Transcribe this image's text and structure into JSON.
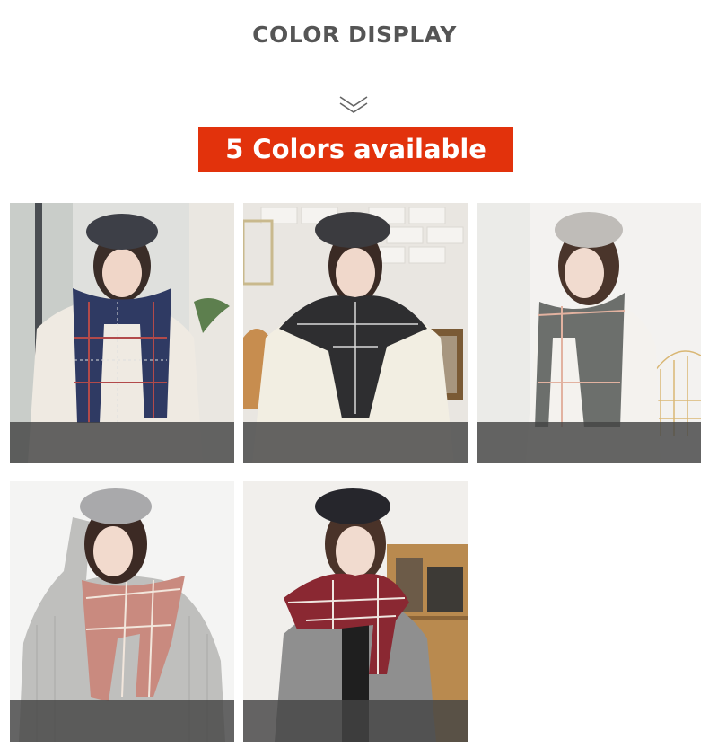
{
  "header": {
    "title": "COLOR DISPLAY",
    "banner": "5 Colors available"
  },
  "icons": {
    "scroll_hint": "double-chevron-down-icon"
  },
  "colors": {
    "banner_bg": "#e2320c",
    "title_text": "#555555",
    "caption_strip": "#444444"
  },
  "color_options": [
    {
      "scarf_color": "#2f3a63",
      "stripe_color": "#b24a4a",
      "sweater_color": "#efeae2",
      "hat_color": "#3d3f47"
    },
    {
      "scarf_color": "#2e2e30",
      "stripe_color": "#d9d9d9",
      "sweater_color": "#f2eee2",
      "hat_color": "#3b3b3f"
    },
    {
      "scarf_color": "#6c6f6c",
      "stripe_color": "#e2b2a0",
      "sweater_color": "#f4f2ee",
      "hat_color": "#bfbcb8"
    },
    {
      "scarf_color": "#c98a7f",
      "stripe_color": "#f2e6dc",
      "sweater_color": "#bfbfbd",
      "hat_color": "#a9a9ab"
    },
    {
      "scarf_color": "#8a2832",
      "stripe_color": "#efe6e0",
      "sweater_color": "#8f8f8f",
      "hat_color": "#26262c"
    }
  ]
}
